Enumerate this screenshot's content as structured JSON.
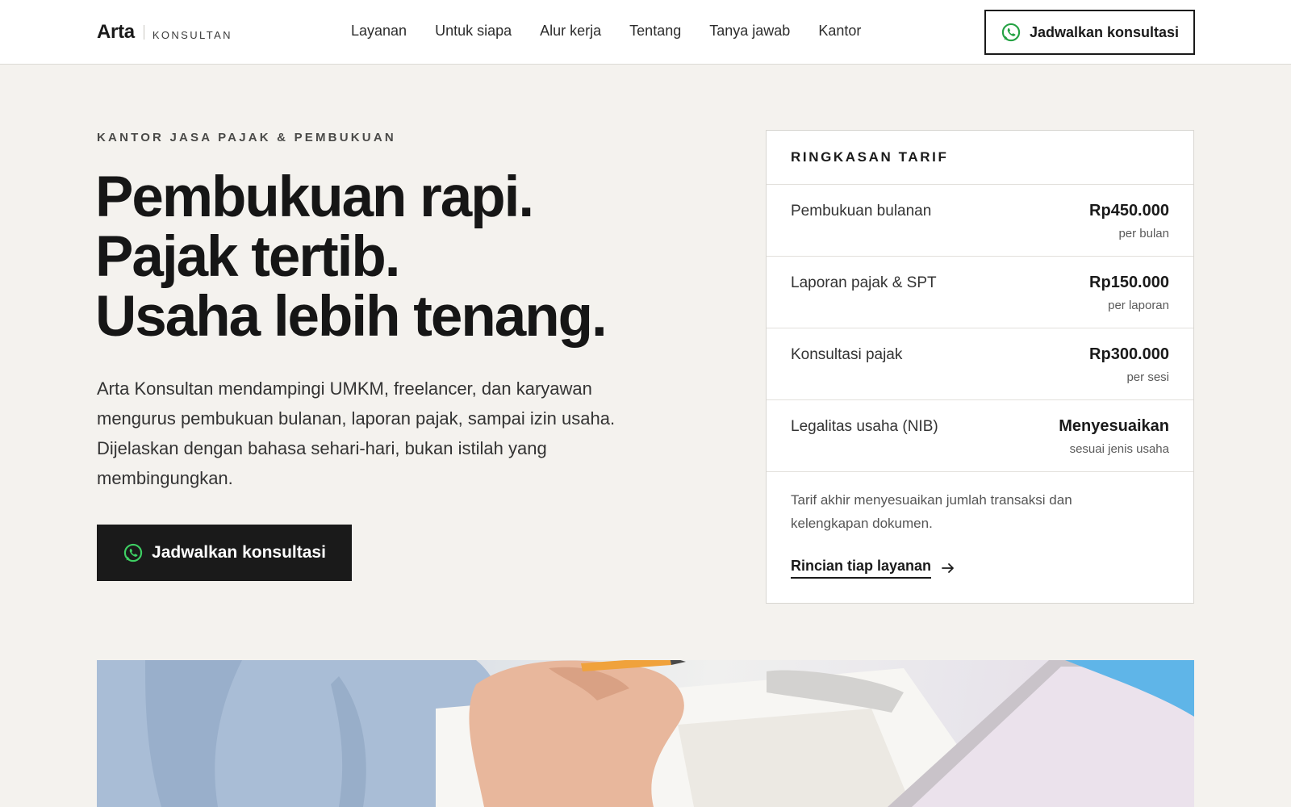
{
  "header": {
    "logo_main": "Arta",
    "logo_sub": "KONSULTAN",
    "nav": [
      "Layanan",
      "Untuk siapa",
      "Alur kerja",
      "Tentang",
      "Tanya jawab",
      "Kantor"
    ],
    "cta_label": "Jadwalkan konsultasi"
  },
  "hero": {
    "eyebrow": "KANTOR JASA PAJAK & PEMBUKUAN",
    "headline": [
      "Pembukuan rapi.",
      "Pajak tertib.",
      "Usaha lebih tenang."
    ],
    "lead": "Arta Konsultan mendampingi UMKM, freelancer, dan karyawan mengurus pembukuan bulanan, laporan pajak, sampai izin usaha. Dijelaskan dengan bahasa sehari-hari, bukan istilah yang membingungkan.",
    "cta_label": "Jadwalkan konsultasi"
  },
  "pricing": {
    "title": "RINGKASAN TARIF",
    "rows": [
      {
        "name": "Pembukuan bulanan",
        "value": "Rp450.000",
        "unit": "per bulan"
      },
      {
        "name": "Laporan pajak & SPT",
        "value": "Rp150.000",
        "unit": "per laporan"
      },
      {
        "name": "Konsultasi pajak",
        "value": "Rp300.000",
        "unit": "per sesi"
      },
      {
        "name": "Legalitas usaha (NIB)",
        "value": "Menyesuaikan",
        "unit": "sesuai jenis usaha"
      }
    ],
    "note": "Tarif akhir menyesuaikan jumlah transaksi dan kelengkapan dokumen.",
    "link_label": "Rincian tiap layanan"
  },
  "colors": {
    "background": "#f4f2ee",
    "text": "#1a1a1a",
    "whatsapp_green": "#25a244"
  },
  "icons": [
    "whatsapp-icon",
    "arrow-right-icon"
  ]
}
